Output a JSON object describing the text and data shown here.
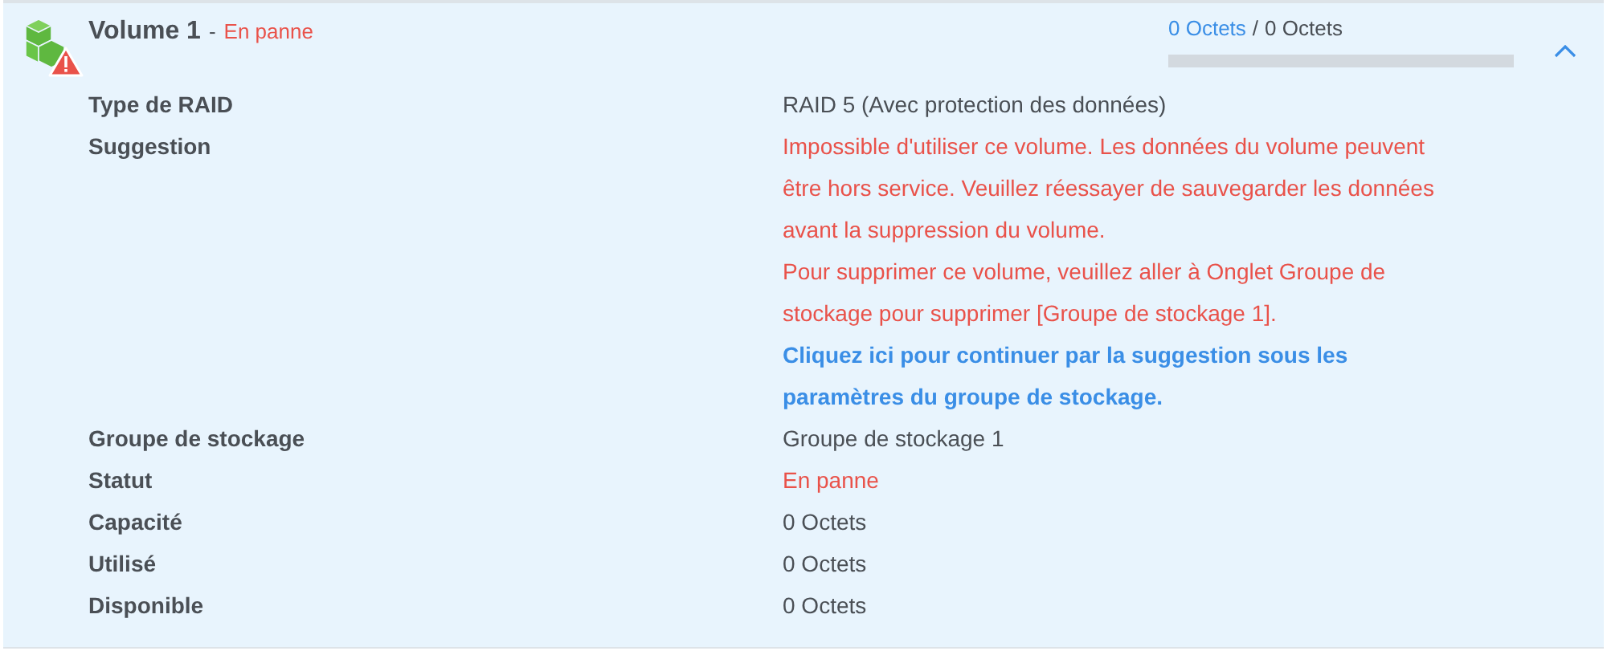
{
  "volume": {
    "title": "Volume 1",
    "separator": "-",
    "status": "En panne",
    "used": "0 Octets",
    "slash": "/",
    "total": "0 Octets",
    "level": 0,
    "expanded": true
  },
  "rows": [
    {
      "label": "Type de RAID",
      "kind": "text",
      "value": "RAID 5 (Avec protection des données)"
    },
    {
      "label": "Suggestion",
      "kind": "suggestion",
      "paragraphs": [
        {
          "text": "Impossible d'utiliser ce volume. Les données du volume peuvent être hors service. Veuillez réessayer de sauvegarder les données avant la suppression du volume."
        },
        {
          "text": "Pour supprimer ce volume, veuillez aller à Onglet Groupe de stockage pour supprimer [Groupe de stockage 1].",
          "link": "Cliquez ici pour continuer par la suggestion sous les paramètres du groupe de stockage."
        }
      ]
    },
    {
      "label": "Groupe de stockage",
      "kind": "text",
      "value": "Groupe de stockage 1"
    },
    {
      "label": "Statut",
      "kind": "error",
      "value": "En panne"
    },
    {
      "label": "Capacité",
      "kind": "text",
      "value": "0 Octets"
    },
    {
      "label": "Utilisé",
      "kind": "text",
      "value": "0 Octets"
    },
    {
      "label": "Disponible",
      "kind": "text",
      "value": "0 Octets"
    }
  ]
}
